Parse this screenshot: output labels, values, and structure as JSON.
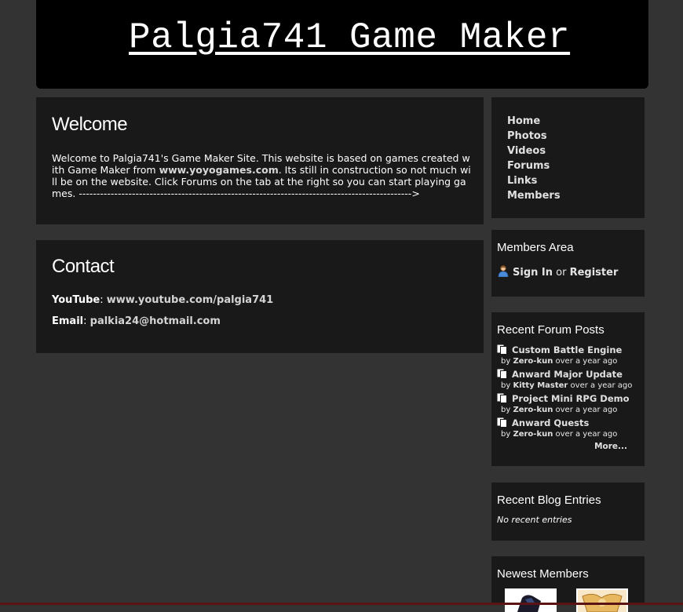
{
  "header": {
    "title": "Palgia741 Game Maker"
  },
  "welcome": {
    "heading": "Welcome",
    "text_before": "Welcome to Palgia741's Game Maker Site. This website is based on games created with Game Maker from ",
    "link": "www.yoyogames.com",
    "text_after": ". Its still in construction so not much will be on the website. Click Forums on the tab at the right so you can start playing games. ---------------------------------------------------------------------------------------------->"
  },
  "contact": {
    "heading": "Contact",
    "youtube_label": "YouTube",
    "youtube_value": "www.youtube.com/palgia741",
    "email_label": "Email",
    "email_value": "palkia24@hotmail.com"
  },
  "nav": {
    "items": [
      {
        "label": "Home"
      },
      {
        "label": "Photos"
      },
      {
        "label": "Videos"
      },
      {
        "label": "Forums"
      },
      {
        "label": "Links"
      },
      {
        "label": "Members"
      }
    ]
  },
  "members_area": {
    "title": "Members Area",
    "sign_in": "Sign In",
    "or": "or",
    "register": "Register",
    "icon": "user-icon"
  },
  "forum": {
    "title": "Recent Forum Posts",
    "by": "by",
    "posts": [
      {
        "title": "Custom Battle Engine",
        "author": "Zero-kun",
        "time": "over a year ago"
      },
      {
        "title": "Anward Major Update",
        "author": "Kitty Master",
        "time": "over a year ago"
      },
      {
        "title": "Project Mini RPG Demo",
        "author": "Zero-kun",
        "time": "over a year ago"
      },
      {
        "title": "Anward Quests",
        "author": "Zero-kun",
        "time": "over a year ago"
      }
    ],
    "more": "More..."
  },
  "blog": {
    "title": "Recent Blog Entries",
    "empty": "No recent entries"
  },
  "newest_members": {
    "title": "Newest Members"
  },
  "colors": {
    "background": "#333333",
    "panel": "#191919",
    "header": "#000000",
    "bottom_bar": "#5a1414"
  }
}
